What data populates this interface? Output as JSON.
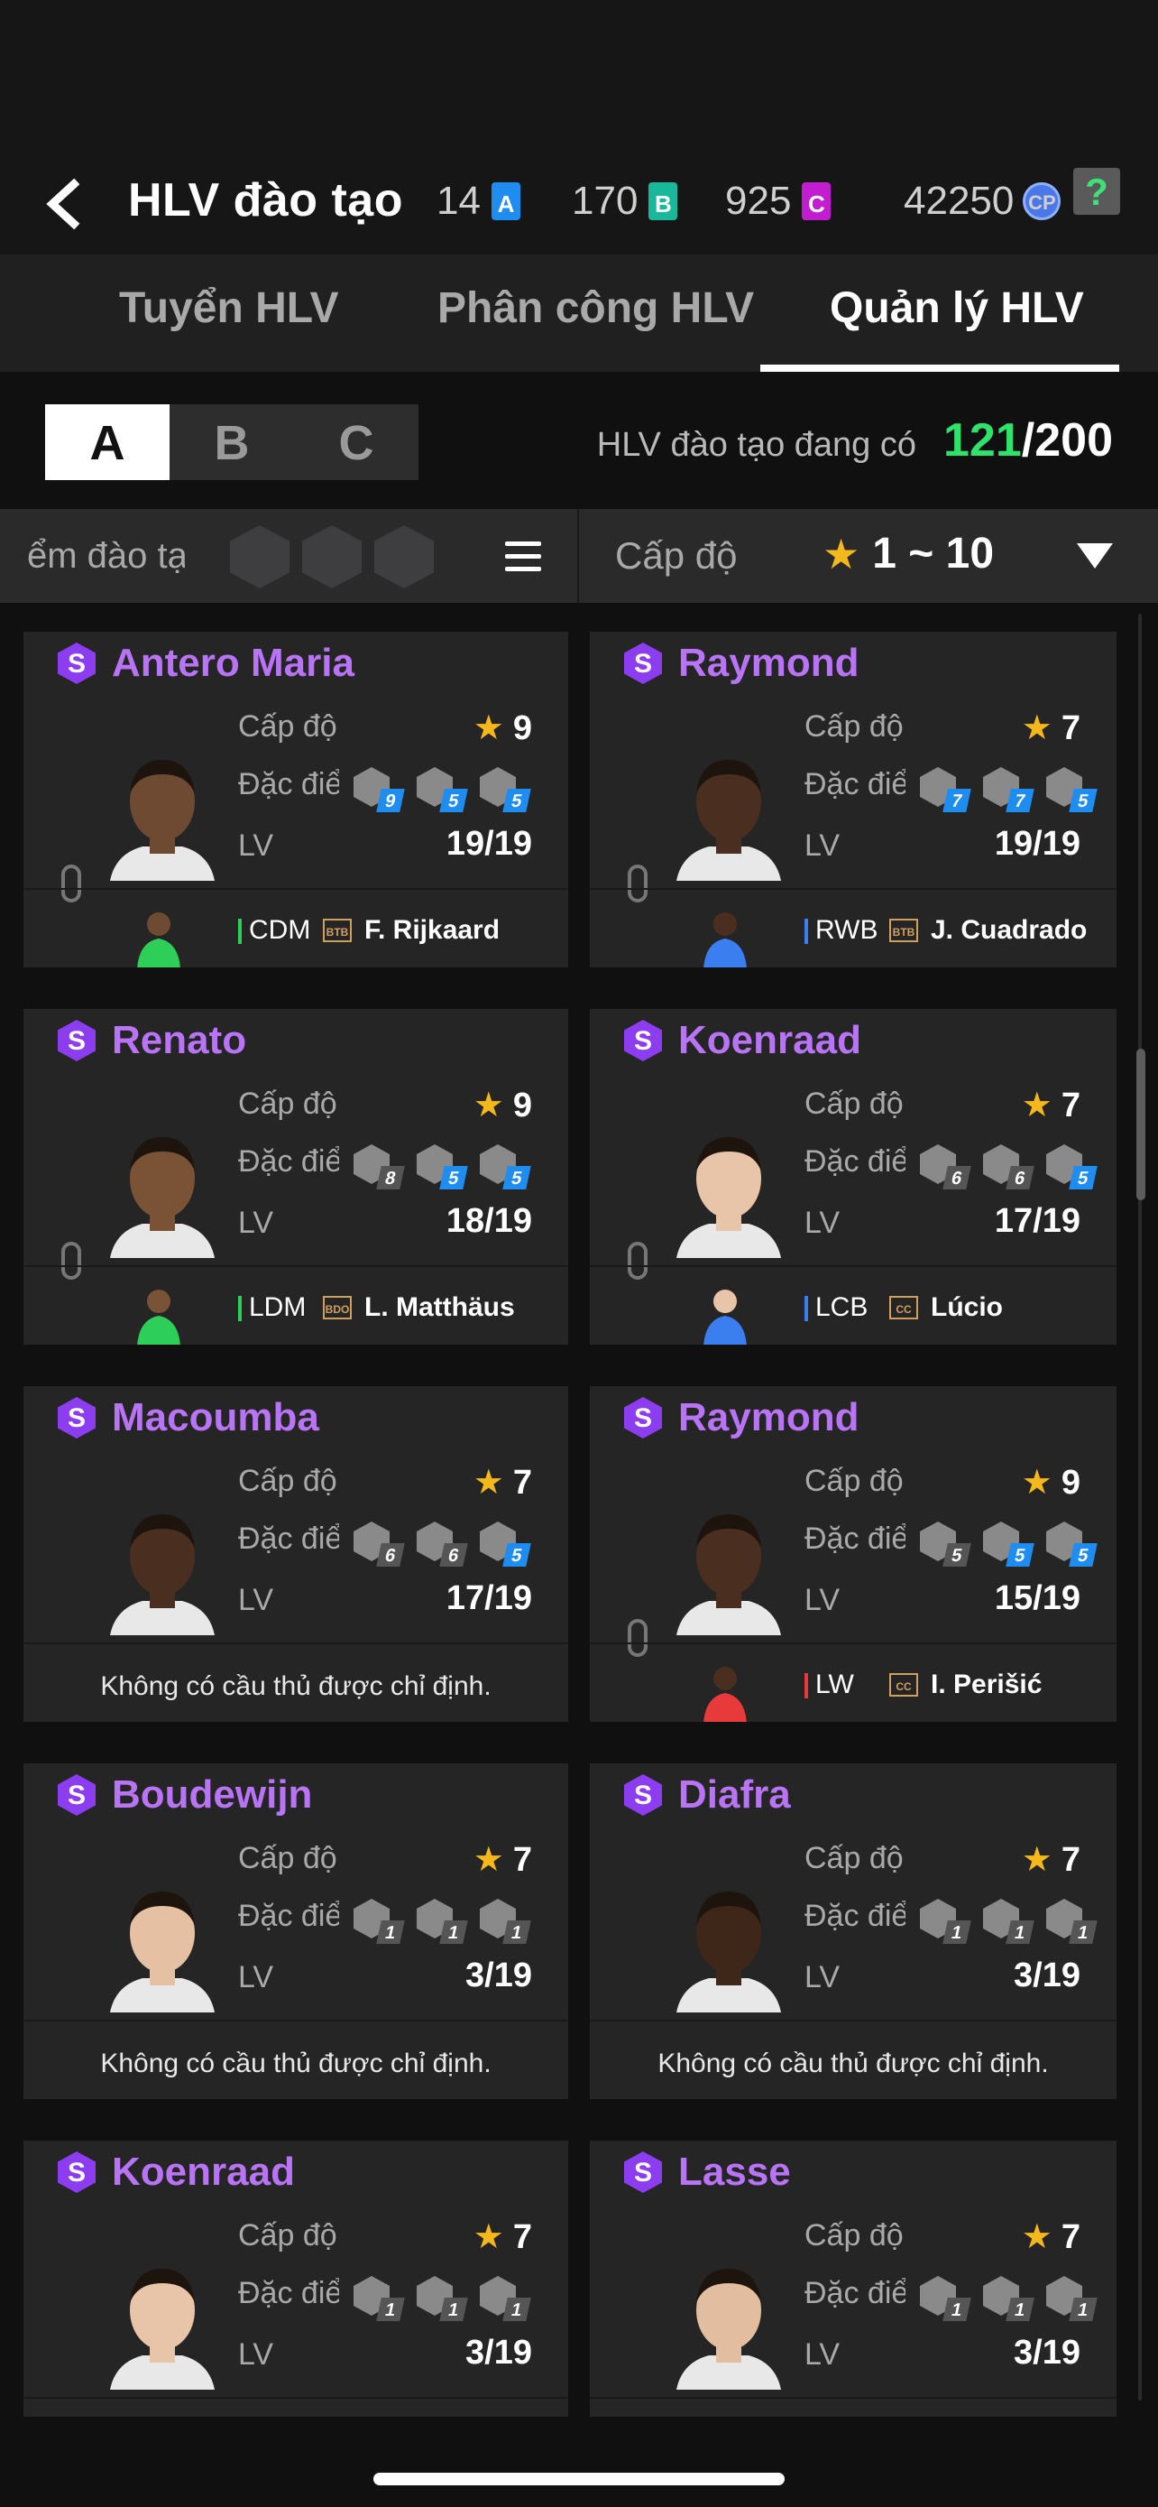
{
  "header": {
    "title": "HLV đào tạo",
    "currencies": [
      {
        "value": "14",
        "icon": "A",
        "color": "#1f8df0"
      },
      {
        "value": "170",
        "icon": "B",
        "color": "#19b89a"
      },
      {
        "value": "925",
        "icon": "C",
        "color": "#c21ecf"
      },
      {
        "value": "42250",
        "icon": "CP",
        "color": "#4a78e8"
      }
    ],
    "help_label": "?"
  },
  "tabs": [
    {
      "label": "Tuyển HLV"
    },
    {
      "label": "Phân công  HLV"
    },
    {
      "label": "Quản lý HLV"
    }
  ],
  "segments": [
    "A",
    "B",
    "C"
  ],
  "capacity": {
    "label": "HLV đào tạo đang có",
    "count": "121",
    "max": "/200"
  },
  "filter": {
    "trait_label": "ểm đào tạo",
    "level_label": "Cấp độ",
    "level_range": "1 ~ 10"
  },
  "labels": {
    "level": "Cấp độ",
    "traits": "Đặc điểm",
    "traits_cut": "Đặc điểm",
    "lv": "LV",
    "no_assign": "Không có cầu thủ được chỉ định."
  },
  "coaches": [
    {
      "name": "Antero Maria",
      "badge": "S",
      "level": "9",
      "traits": [
        [
          "9",
          "blue"
        ],
        [
          "5",
          "blue"
        ],
        [
          "5",
          "blue"
        ]
      ],
      "lv": "19/19",
      "pos": "CDM",
      "pos_color": "#2ecf58",
      "season": "BTB",
      "player": "F. Rijkaard",
      "skin": "#6e4a32"
    },
    {
      "name": "Raymond",
      "badge": "S",
      "level": "7",
      "traits": [
        [
          "7",
          "blue"
        ],
        [
          "7",
          "blue"
        ],
        [
          "5",
          "blue"
        ]
      ],
      "lv": "19/19",
      "pos": "RWB",
      "pos_color": "#3a7ef0",
      "season": "BTB",
      "player": "J. Cuadrado",
      "skin": "#4a2e20"
    },
    {
      "name": "Renato",
      "badge": "S",
      "level": "9",
      "traits": [
        [
          "8",
          "gray"
        ],
        [
          "5",
          "blue"
        ],
        [
          "5",
          "blue"
        ]
      ],
      "lv": "18/19",
      "pos": "LDM",
      "pos_color": "#2ecf58",
      "season": "BDO",
      "player": "L. Matthäus",
      "skin": "#7a5236"
    },
    {
      "name": "Koenraad",
      "badge": "S",
      "level": "7",
      "traits": [
        [
          "6",
          "gray"
        ],
        [
          "6",
          "gray"
        ],
        [
          "5",
          "blue"
        ]
      ],
      "lv": "17/19",
      "pos": "LCB",
      "pos_color": "#3a7ef0",
      "season": "CC",
      "player": "Lúcio",
      "skin": "#e8c4a8"
    },
    {
      "name": "Macoumba",
      "badge": "S",
      "level": "7",
      "traits": [
        [
          "6",
          "gray"
        ],
        [
          "6",
          "gray"
        ],
        [
          "5",
          "blue"
        ]
      ],
      "lv": "17/19",
      "pos": "",
      "pos_color": "",
      "season": "",
      "player": "",
      "skin": "#4a2e20"
    },
    {
      "name": "Raymond",
      "badge": "S",
      "level": "9",
      "traits": [
        [
          "5",
          "gray"
        ],
        [
          "5",
          "blue"
        ],
        [
          "5",
          "blue"
        ]
      ],
      "lv": "15/19",
      "pos": "LW",
      "pos_color": "#e83a3a",
      "season": "CC",
      "player": "I. Perišić",
      "skin": "#4a2e20"
    },
    {
      "name": "Boudewijn",
      "badge": "S",
      "level": "7",
      "traits": [
        [
          "1",
          "gray"
        ],
        [
          "1",
          "gray"
        ],
        [
          "1",
          "gray"
        ]
      ],
      "lv": "3/19",
      "pos": "",
      "pos_color": "",
      "season": "",
      "player": "",
      "skin": "#e6c0a2"
    },
    {
      "name": "Diafra",
      "badge": "S",
      "level": "7",
      "traits": [
        [
          "1",
          "gray"
        ],
        [
          "1",
          "gray"
        ],
        [
          "1",
          "gray"
        ]
      ],
      "lv": "3/19",
      "pos": "",
      "pos_color": "",
      "season": "",
      "player": "",
      "skin": "#3e2619"
    },
    {
      "name": "Koenraad",
      "badge": "S",
      "level": "7",
      "traits": [
        [
          "1",
          "gray"
        ],
        [
          "1",
          "gray"
        ],
        [
          "1",
          "gray"
        ]
      ],
      "lv": "3/19",
      "pos": "",
      "pos_color": "",
      "season": "",
      "player": "",
      "skin": "#e8c4a8"
    },
    {
      "name": "Lasse",
      "badge": "S",
      "level": "7",
      "traits": [
        [
          "1",
          "gray"
        ],
        [
          "1",
          "gray"
        ],
        [
          "1",
          "gray"
        ]
      ],
      "lv": "3/19",
      "pos": "",
      "pos_color": "",
      "season": "",
      "player": "",
      "skin": "#e2bda0"
    }
  ]
}
